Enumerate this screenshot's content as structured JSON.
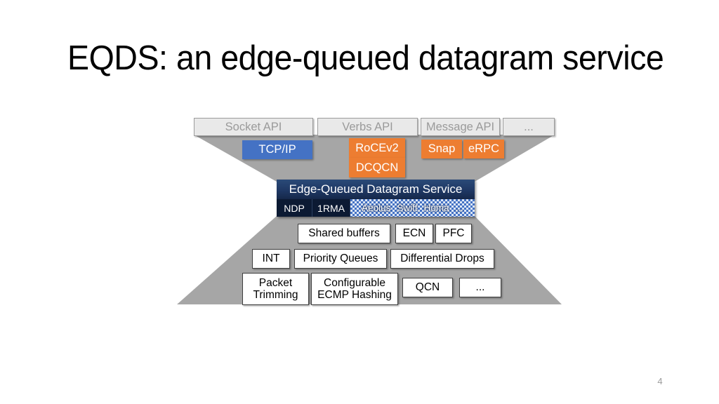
{
  "slide": {
    "title": "EQDS: an edge-queued datagram service",
    "page_number": "4"
  },
  "colors": {
    "gray_shape": "#A6A6A6",
    "api_box_fill": "#E9E9E9",
    "api_box_text": "#9A9A9A",
    "blue": "#4472C4",
    "orange": "#ED7D31",
    "navy": "#1F3864",
    "navy_dark": "#0C1A33",
    "feature_border": "#3F3F3F",
    "page_number": "#9C9C9C"
  },
  "diagram": {
    "api_row": [
      {
        "label": "Socket API"
      },
      {
        "label": "Verbs API"
      },
      {
        "label": "Message API"
      },
      {
        "label": "..."
      }
    ],
    "protocol_row": [
      {
        "label": "TCP/IP",
        "color": "blue"
      },
      {
        "label": "RoCEv2",
        "color": "orange"
      },
      {
        "label": "DCQCN",
        "color": "orange"
      },
      {
        "label": "Snap",
        "color": "orange"
      },
      {
        "label": "eRPC",
        "color": "orange"
      }
    ],
    "waist": {
      "title": "Edge-Queued Datagram Service",
      "solid_items": [
        {
          "label": "NDP"
        },
        {
          "label": "1RMA"
        }
      ],
      "patterned_items": [
        {
          "label": "Aeolus"
        },
        {
          "label": "Swift"
        },
        {
          "label": "Homa"
        },
        {
          "label": "..."
        }
      ]
    },
    "feature_rows": [
      [
        {
          "label": "Shared buffers"
        },
        {
          "label": "ECN"
        },
        {
          "label": "PFC"
        }
      ],
      [
        {
          "label": "INT"
        },
        {
          "label": "Priority Queues"
        },
        {
          "label": "Differential Drops"
        }
      ],
      [
        {
          "label": "Packet\nTrimming"
        },
        {
          "label": "Configurable\nECMP Hashing"
        },
        {
          "label": "QCN"
        },
        {
          "label": "..."
        }
      ]
    ]
  }
}
